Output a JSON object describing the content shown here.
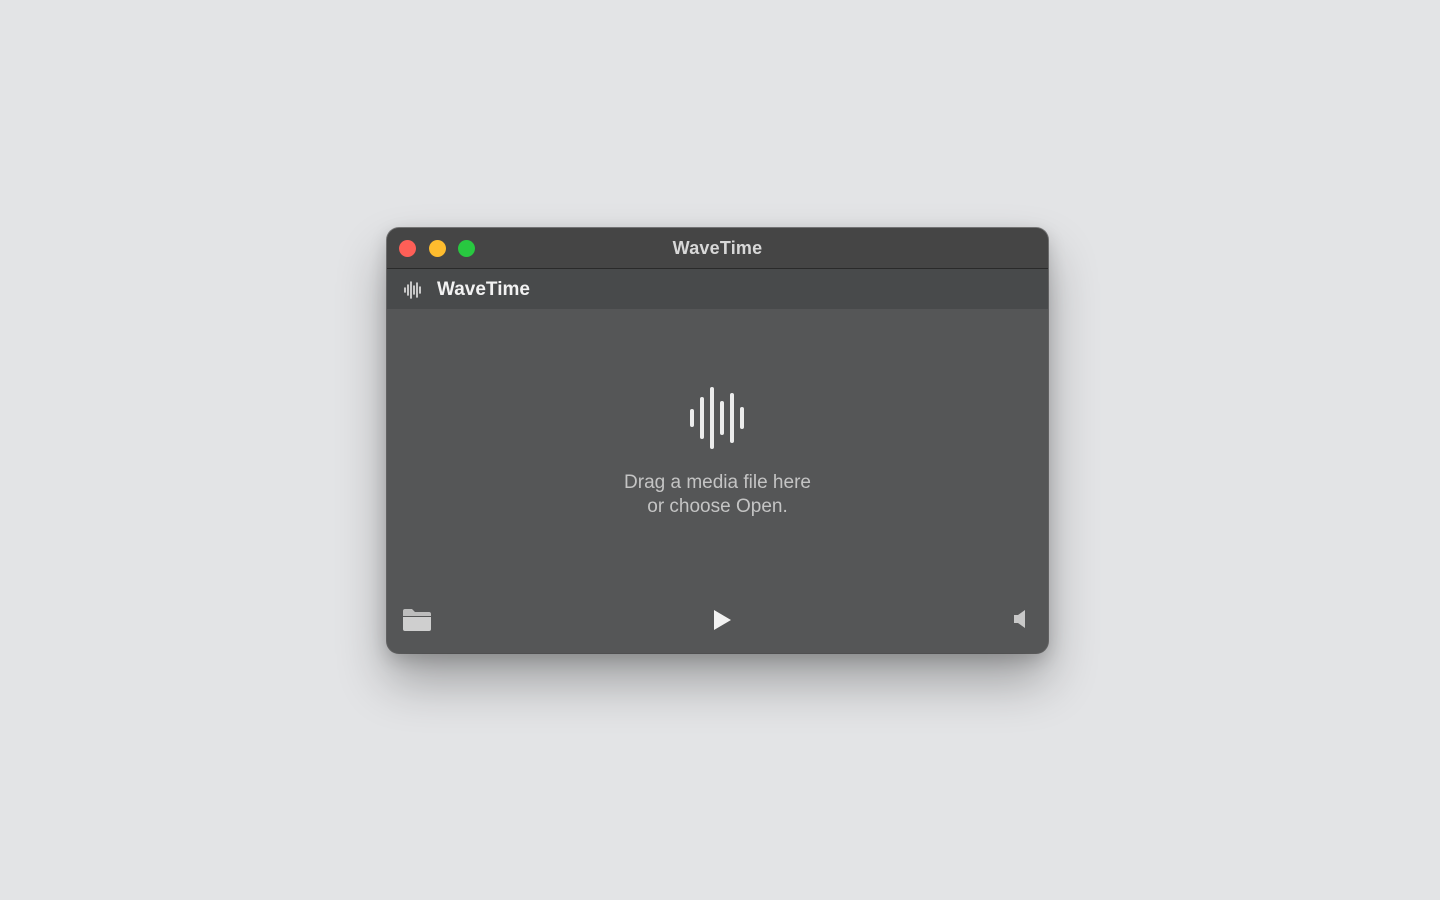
{
  "window": {
    "title": "WaveTime",
    "traffic_lights": [
      {
        "name": "close",
        "color": "#fe5f57"
      },
      {
        "name": "minimize",
        "color": "#febc2e"
      },
      {
        "name": "zoom",
        "color": "#28c840"
      }
    ]
  },
  "toolbar": {
    "icon": "waveform-icon",
    "app_name": "WaveTime"
  },
  "empty_state": {
    "icon": "waveform-icon",
    "line1": "Drag a media file here",
    "line2": "or choose Open."
  },
  "controls": {
    "open": {
      "icon": "folder-icon"
    },
    "play": {
      "icon": "play-icon"
    },
    "volume": {
      "icon": "speaker-icon"
    }
  },
  "colors": {
    "desktop": "#e3e4e6",
    "window_bg": "#555657",
    "titlebar_bg": "#454545",
    "toolbar_bg": "#484a4b",
    "text_primary": "#f2f2f2",
    "text_secondary": "#c4c4c4"
  }
}
